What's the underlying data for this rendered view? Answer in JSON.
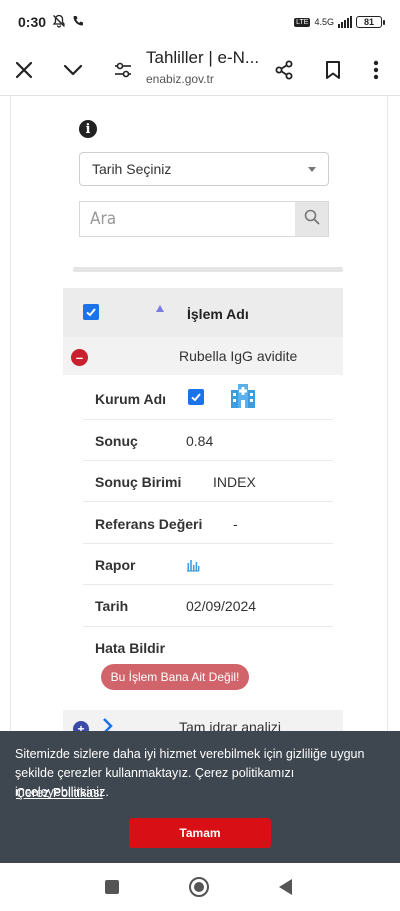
{
  "status_bar": {
    "time": "0:30",
    "network": "4.5G",
    "battery": "81"
  },
  "browser": {
    "title": "Tahliller | e-N...",
    "url": "enabiz.gov.tr"
  },
  "filters": {
    "date_select": "Tarih Seçiniz",
    "search_placeholder": "Ara"
  },
  "table": {
    "header": "İşlem Adı",
    "rows": [
      {
        "name": "Rubella IgG avidite",
        "expanded": true
      },
      {
        "name": "Tam idrar analizi",
        "expanded": false
      }
    ]
  },
  "details": {
    "kurum_label": "Kurum Adı",
    "sonuc_label": "Sonuç",
    "sonuc_value": "0.84",
    "birim_label": "Sonuç Birimi",
    "birim_value": "INDEX",
    "referans_label": "Referans Değeri",
    "referans_value": "-",
    "rapor_label": "Rapor",
    "tarih_label": "Tarih",
    "tarih_value": "02/09/2024",
    "hata_label": "Hata Bildir",
    "hata_button": "Bu İşlem Bana Ait Değil!"
  },
  "cookie": {
    "message": "Sitemizde sizlere daha iyi hizmet verebilmek için gizliliğe uygun şekilde çerezler kullanmaktayız. Çerez politikamızı inceleyebilirsiniz.",
    "policy_link": "Çerez Politikası",
    "accept_button": "Tamam"
  },
  "colors": {
    "accent_blue": "#1a73e8",
    "danger_red": "#d90f16",
    "banner_bg": "#3e4650",
    "report_button": "#d1646b"
  }
}
